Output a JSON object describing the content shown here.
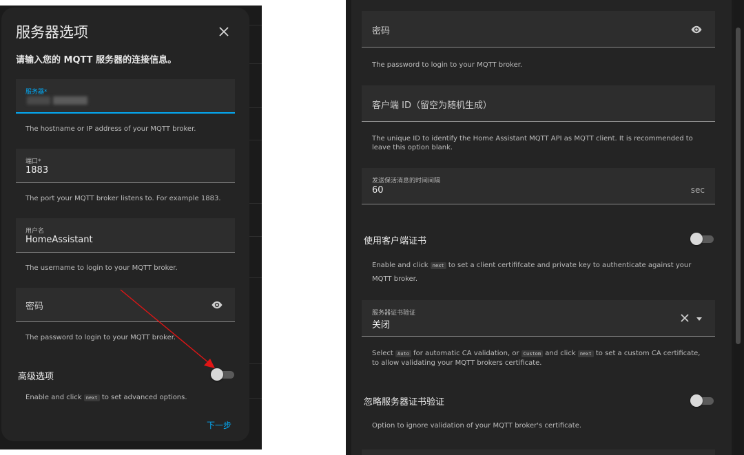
{
  "dialog": {
    "title": "服务器选项",
    "description": "请输入您的 MQTT 服务器的连接信息。",
    "broker": {
      "label": "服务器*",
      "helper": "The hostname or IP address of your MQTT broker."
    },
    "port": {
      "label": "端口*",
      "value": "1883",
      "helper": "The port your MQTT broker listens to. For example 1883."
    },
    "username": {
      "label": "用户名",
      "value": "HomeAssistant",
      "helper": "The username to login to your MQTT broker."
    },
    "password": {
      "placeholder": "密码",
      "helper": "The password to login to your MQTT broker."
    },
    "advanced": {
      "label": "高级选项",
      "helper_pre": "Enable and click",
      "helper_kw": "next",
      "helper_post": "to set advanced options.",
      "enabled": false
    },
    "next_label": "下一步"
  },
  "right": {
    "password": {
      "placeholder": "密码",
      "helper": "The password to login to your MQTT broker."
    },
    "client_id": {
      "placeholder": "客户端 ID（留空为随机生成）",
      "helper": "The unique ID to identify the Home Assistant MQTT API as MQTT client. It is recommended to leave this option blank."
    },
    "keepalive": {
      "label": "发送保活消息的时间间隔",
      "value": "60",
      "suffix": "sec"
    },
    "client_cert": {
      "label": "使用客户端证书",
      "helper_pre": "Enable and click",
      "helper_kw": "next",
      "helper_post": "to set a client certififcate and private key to authenticate against your MQTT broker.",
      "enabled": false
    },
    "cert_validation": {
      "label": "服务器证书验证",
      "value": "关闭",
      "helper_1": "Select",
      "helper_kw1": "Auto",
      "helper_2": "for automatic CA validation, or",
      "helper_kw2": "Custom",
      "helper_3": "and click",
      "helper_kw3": "next",
      "helper_4": "to set a custom CA certificate, to allow validating your MQTT brokers certificate."
    },
    "ignore_cert": {
      "label": "忽略服务器证书验证",
      "helper": "Option to ignore validation of your MQTT broker's certificate.",
      "enabled": false
    }
  },
  "colors": {
    "accent": "#03a9f4",
    "annotation_arrow": "#e01515",
    "dialog_bg": "#242424",
    "field_bg": "#2d2d2d"
  }
}
